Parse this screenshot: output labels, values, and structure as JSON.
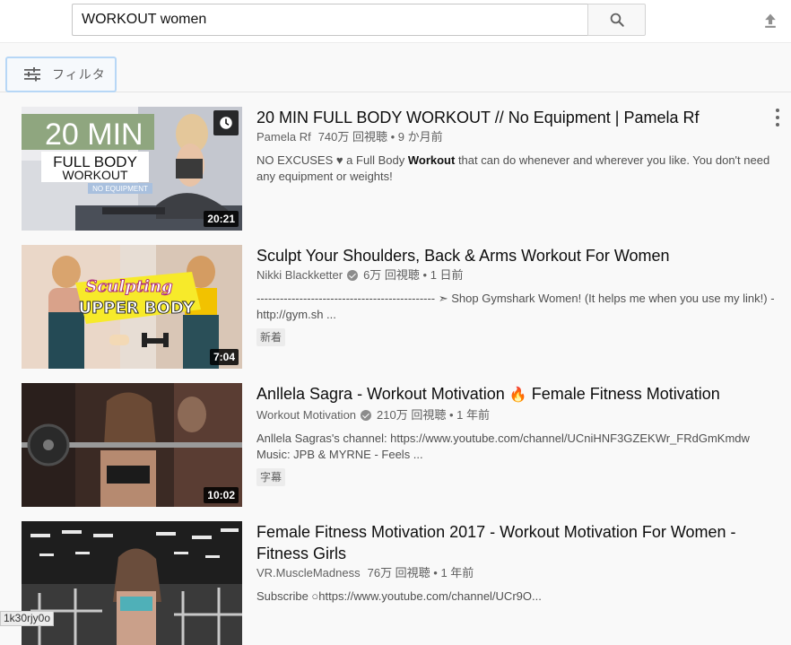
{
  "search": {
    "query": "WORKOUT women"
  },
  "filter": {
    "label": "フィルタ"
  },
  "results": [
    {
      "title": "20 MIN FULL BODY WORKOUT // No Equipment | Pamela Rf",
      "channel": "Pamela Rf",
      "stats": "740万 回視聴 • 9 か月前",
      "desc_pre": "NO EXCUSES ♥ a Full Body ",
      "desc_bold": "Workout",
      "desc_post": " that can do whenever and wherever you like. You don't need any equipment or weights!",
      "duration": "20:21",
      "thumb_text_big": "20 MIN",
      "thumb_text_1": "FULL BODY",
      "thumb_text_2": "WORKOUT",
      "thumb_text_3": "NO EQUIPMENT"
    },
    {
      "title": "Sculpt Your Shoulders, Back & Arms Workout For Women",
      "channel": "Nikki Blackketter",
      "stats": "6万 回視聴 • 1 日前",
      "desc": "---------------------------------------------- ➣ Shop Gymshark Women! (It helps me when you use my link!) - http://gym.sh ...",
      "badge": "新着",
      "duration": "7:04",
      "thumb_text_1": "Sculpting",
      "thumb_text_2": "UPPER BODY"
    },
    {
      "title_pre": "Anllela Sagra - Workout Motivation ",
      "title_emoji": "🔥",
      "title_post": " Female Fitness Motivation",
      "channel": "Workout Motivation",
      "stats": "210万 回視聴 • 1 年前",
      "desc": "Anllela Sagras's channel: https://www.youtube.com/channel/UCniHNF3GZEKWr_FRdGmKmdw Music: JPB & MYRNE - Feels ...",
      "badge": "字幕",
      "duration": "10:02"
    },
    {
      "title": "Female Fitness Motivation 2017 - Workout Motivation For Women - Fitness Girls",
      "channel": "VR.MuscleMadness",
      "stats": "76万 回視聴 • 1 年前",
      "desc": "Subscribe ○https://www.youtube.com/channel/UCr9O..."
    }
  ],
  "status_tip": "1k30rjy0o",
  "icons": {
    "search": "search-icon",
    "upload": "upload-icon",
    "filter": "tune-icon",
    "watch_later": "clock-icon",
    "more": "more-vert-icon",
    "verified": "verified-check-icon"
  }
}
